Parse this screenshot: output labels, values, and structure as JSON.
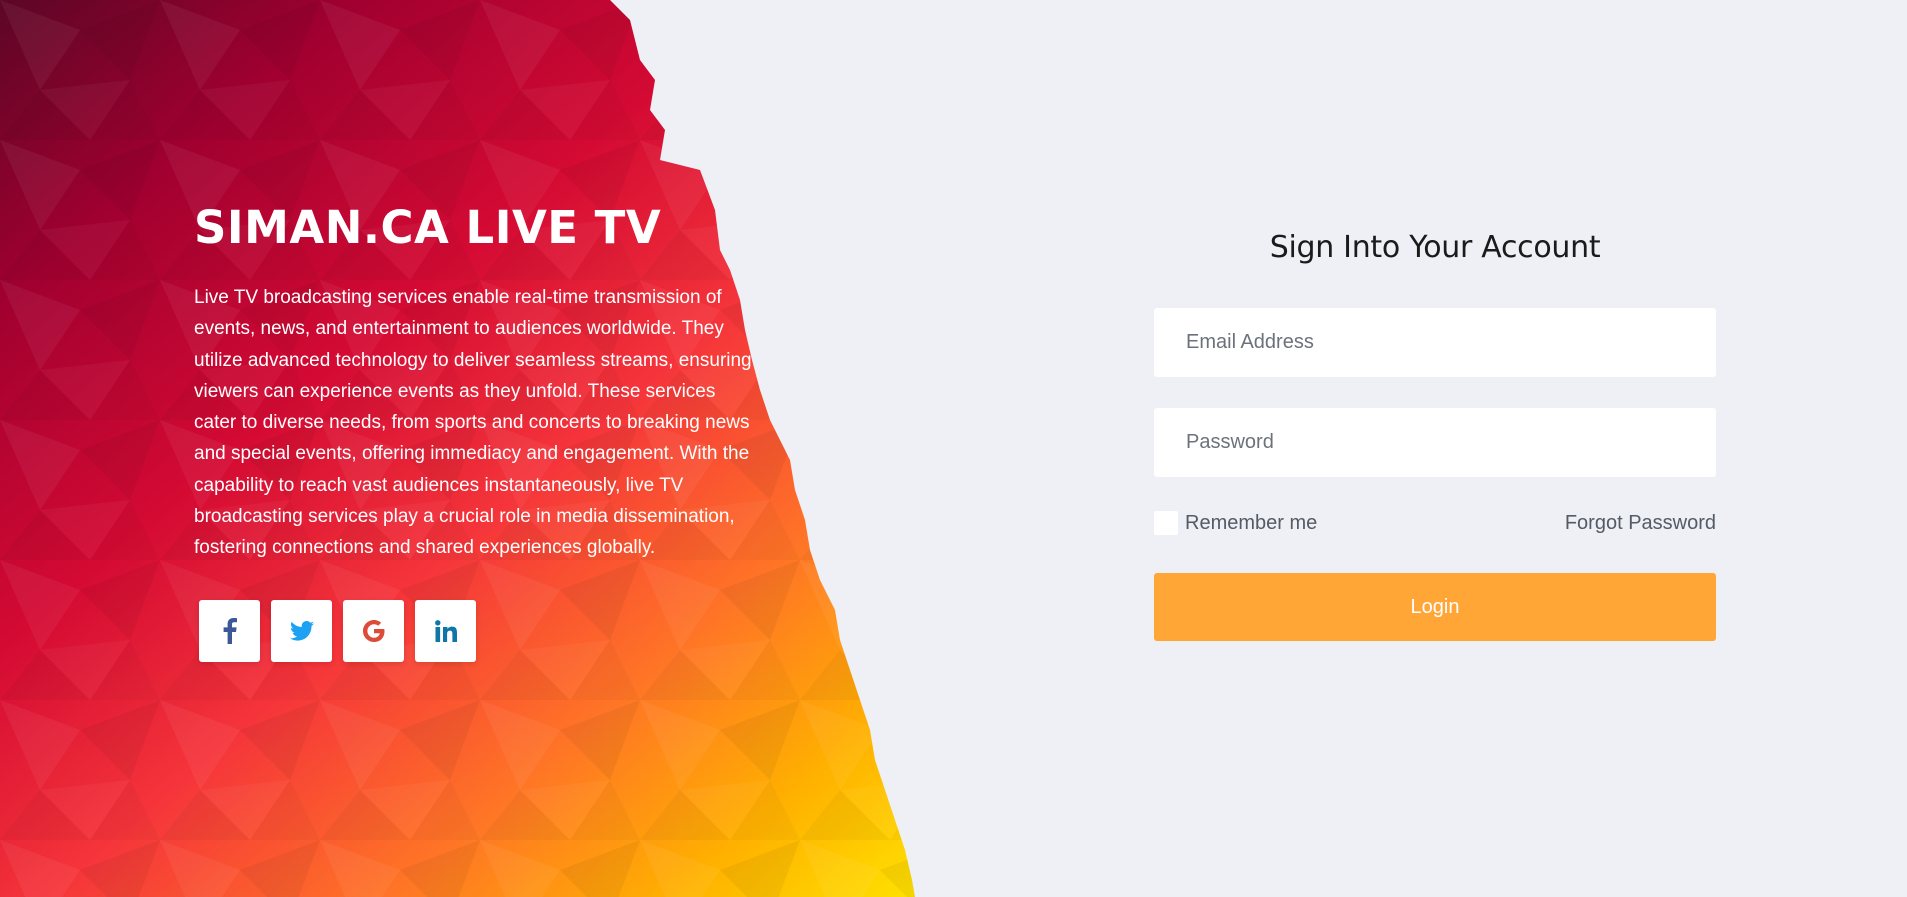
{
  "brand": {
    "title": "SIMAN.CA LIVE TV",
    "description": "Live TV broadcasting services enable real-time transmission of events, news, and entertainment to audiences worldwide. They utilize advanced technology to deliver seamless streams, ensuring viewers can experience events as they unfold. These services cater to diverse needs, from sports and concerts to breaking news and special events, offering immediacy and engagement. With the capability to reach vast audiences instantaneously, live TV broadcasting services play a crucial role in media dissemination, fostering connections and shared experiences globally."
  },
  "social": [
    {
      "icon": "facebook-icon",
      "color": "#3b5998"
    },
    {
      "icon": "twitter-icon",
      "color": "#1da1f2"
    },
    {
      "icon": "google-icon",
      "color": "#dd4b39"
    },
    {
      "icon": "linkedin-icon",
      "color": "#0e76a8"
    }
  ],
  "login": {
    "title": "Sign Into Your Account",
    "email_placeholder": "Email Address",
    "email_value": "",
    "password_placeholder": "Password",
    "password_value": "",
    "remember_label": "Remember me",
    "remember_checked": false,
    "forgot_label": "Forgot Password",
    "button_label": "Login"
  },
  "colors": {
    "background": "#eef0f5",
    "accent": "#ffa637",
    "gradient": [
      "#6e0a2a",
      "#c8002e",
      "#ee2a3c",
      "#ff7a22",
      "#ffc200",
      "#ffe600"
    ]
  }
}
